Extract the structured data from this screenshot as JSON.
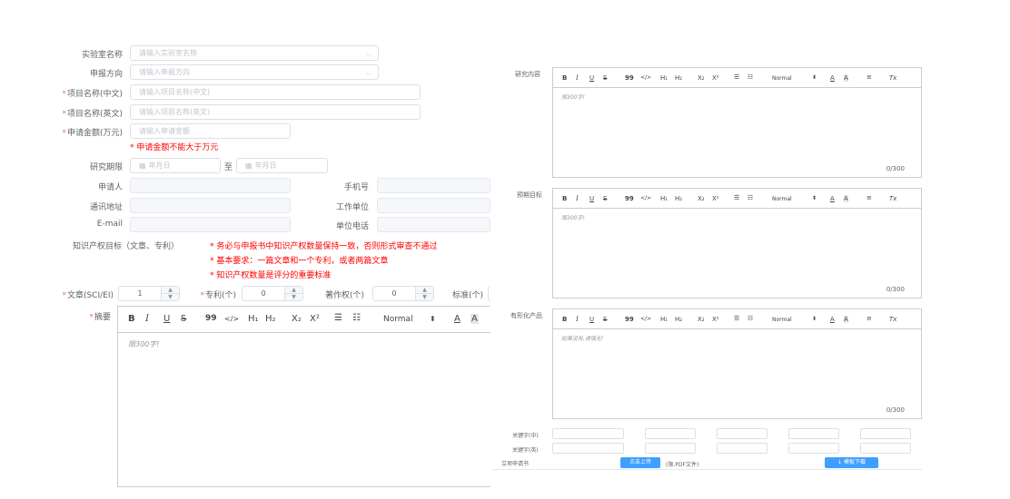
{
  "form": {
    "lab_name": {
      "label": "实验室名称",
      "placeholder": "请输入实验室名称"
    },
    "direction": {
      "label": "申报方向",
      "placeholder": "请输入申报方向"
    },
    "project_cn": {
      "label": "项目名称(中文)",
      "placeholder": "请输入项目名称(中文)"
    },
    "project_en": {
      "label": "项目名称(英文)",
      "placeholder": "请输入项目名称(英文)"
    },
    "amount": {
      "label": "申请金额(万元)",
      "placeholder": "请输入申请金额",
      "error": "申请金额不能大于万元"
    },
    "period": {
      "label": "研究期限",
      "start_placeholder": "年月日",
      "sep": "至",
      "end_placeholder": "年月日"
    },
    "applicant": {
      "label": "申请人"
    },
    "phone": {
      "label": "手机号"
    },
    "address": {
      "label": "通讯地址"
    },
    "workplace": {
      "label": "工作单位"
    },
    "email": {
      "label": "E-mail"
    },
    "unit_phone": {
      "label": "单位电话"
    },
    "ip": {
      "label": "知识产权目标（文章、专利）",
      "notes": [
        "务必与申报书中知识产权数量保持一致，否则形式审查不通过",
        "基本要求：一篇文章和一个专利，或者两篇文章",
        "知识产权数量是评分的重要标准"
      ]
    },
    "counts": [
      {
        "label": "文章(SCI/EI)",
        "value": "1",
        "required": true
      },
      {
        "label": "专利(个)",
        "value": "0",
        "required": true
      },
      {
        "label": "著作权(个)",
        "value": "0",
        "required": false
      },
      {
        "label": "标准(个)",
        "value": "",
        "required": false
      }
    ],
    "abstract": {
      "label": "摘要",
      "placeholder": "限300字!"
    }
  },
  "toolbar": {
    "bold": "B",
    "italic": "I",
    "underline": "U",
    "strike": "S",
    "quote": "99",
    "code": "</>",
    "h1": "H₁",
    "h2": "H₂",
    "sub": "X₂",
    "sup": "X²",
    "ol": "☰",
    "ul": "☷",
    "size": "Normal",
    "size_arrow": "⬍",
    "color": "A",
    "bg": "A",
    "align": "≡",
    "clean": "Tx"
  },
  "right": {
    "editors": [
      {
        "label": "研究内容",
        "placeholder": "限300字!",
        "count": "0/300"
      },
      {
        "label": "预期目标",
        "placeholder": "限300字!",
        "count": "0/300"
      },
      {
        "label": "有形化产品",
        "placeholder": "如果没有,请填无!",
        "count": "0/300"
      }
    ],
    "kw_cn": "关键字(中)",
    "kw_en": "关键字(英)",
    "proposal": "立项申请书",
    "upload_btn": "点击上传",
    "upload_hint": "(限.PDF文件)",
    "template_btn": "↓ 模板下载"
  }
}
